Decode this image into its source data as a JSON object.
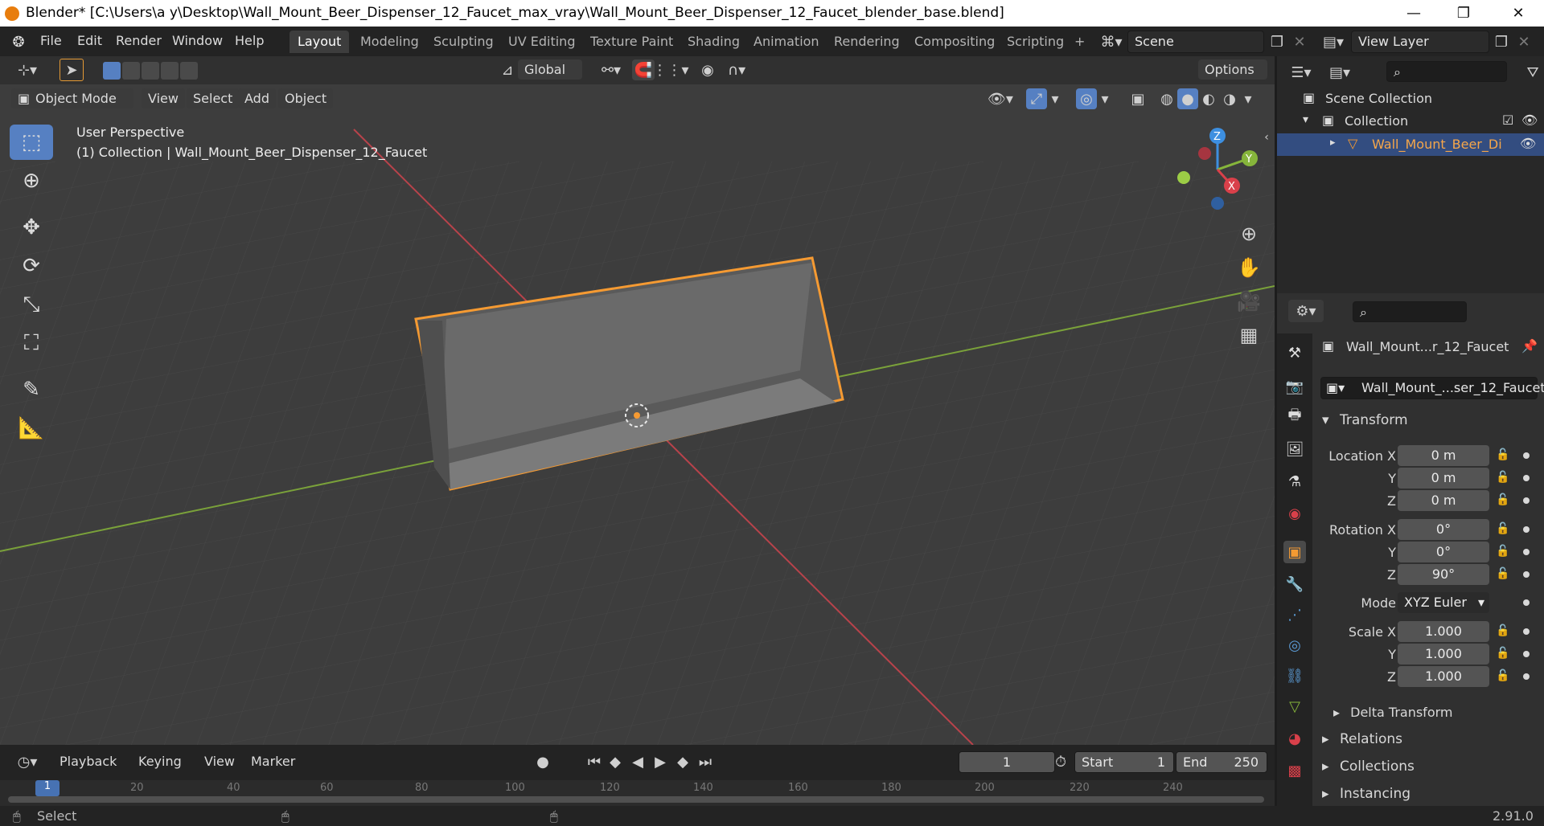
{
  "window": {
    "title": "Blender* [C:\\Users\\a y\\Desktop\\Wall_Mount_Beer_Dispenser_12_Faucet_max_vray\\Wall_Mount_Beer_Dispenser_12_Faucet_blender_base.blend]",
    "minimize": "—",
    "maximize": "❐",
    "close": "✕"
  },
  "menu": {
    "items": [
      "File",
      "Edit",
      "Render",
      "Window",
      "Help"
    ],
    "workspaces": [
      "Layout",
      "Modeling",
      "Sculpting",
      "UV Editing",
      "Texture Paint",
      "Shading",
      "Animation",
      "Rendering",
      "Compositing",
      "Scripting"
    ],
    "active_workspace": "Layout",
    "add_tab": "+",
    "scene_label": "Scene",
    "view_layer_label": "View Layer"
  },
  "header": {
    "transform_orientation": "Global",
    "options_label": "Options",
    "mode": "Object Mode",
    "view_menu": [
      "View",
      "Select",
      "Add",
      "Object"
    ]
  },
  "viewport": {
    "perspective": "User Perspective",
    "collection_info": "(1) Collection | Wall_Mount_Beer_Dispenser_12_Faucet",
    "gizmo_axes": [
      "Z",
      "Y",
      "X"
    ]
  },
  "outliner": {
    "scene_collection": "Scene Collection",
    "collection": "Collection",
    "object": "Wall_Mount_Beer_Di"
  },
  "properties": {
    "object_name": "Wall_Mount...r_12_Faucet",
    "data_name": "Wall_Mount_...ser_12_Faucet",
    "transform_label": "Transform",
    "location_x_label": "Location X",
    "location": [
      "0 m",
      "0 m",
      "0 m"
    ],
    "rotation_x_label": "Rotation X",
    "rotation": [
      "0°",
      "0°",
      "90°"
    ],
    "mode_label": "Mode",
    "rotation_mode": "XYZ Euler",
    "scale_x_label": "Scale X",
    "scale": [
      "1.000",
      "1.000",
      "1.000"
    ],
    "y_label": "Y",
    "z_label": "Z",
    "subpanels": [
      "Delta Transform",
      "Relations",
      "Collections",
      "Instancing"
    ]
  },
  "timeline": {
    "menus": [
      "Playback",
      "Keying",
      "View",
      "Marker"
    ],
    "current_frame": "1",
    "start_label": "Start",
    "start": "1",
    "end_label": "End",
    "end": "250",
    "ruler": [
      "1",
      "20",
      "40",
      "60",
      "80",
      "100",
      "120",
      "140",
      "160",
      "180",
      "200",
      "220",
      "240"
    ]
  },
  "status": {
    "select_label": "Select",
    "version": "2.91.0"
  },
  "colors": {
    "accent": "#5680c2",
    "selection_outline": "#f59a32",
    "axis_x": "#d9404a",
    "axis_y": "#86b53b",
    "axis_z": "#3d8fe0"
  }
}
